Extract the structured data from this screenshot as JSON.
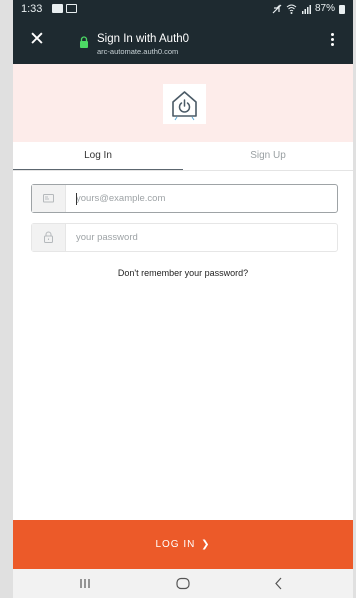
{
  "status_bar": {
    "time": "1:33",
    "battery": "87%"
  },
  "title_bar": {
    "title": "Sign In with Auth0",
    "subtitle": "arc-automate.auth0.com",
    "close_glyph": "✕"
  },
  "tabs": {
    "login": "Log In",
    "signup": "Sign Up"
  },
  "form": {
    "email_placeholder": "yours@example.com",
    "password_placeholder": "your password",
    "forgot_link": "Don't remember your password?"
  },
  "submit": {
    "label": "LOG IN",
    "chevron": "❯"
  },
  "icons": [
    "close-icon",
    "lock-icon",
    "more-vert-icon",
    "home-power-logo",
    "email-icon",
    "password-lock-icon",
    "recents-icon",
    "home-icon",
    "back-icon"
  ],
  "colors": {
    "bar": "#1e2a30",
    "header": "#fdecea",
    "accent": "#ec5a29"
  }
}
